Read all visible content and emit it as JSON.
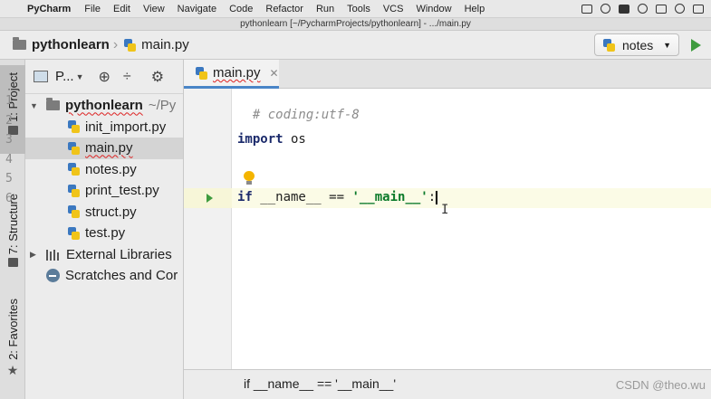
{
  "menubar": {
    "app_name": "PyCharm",
    "items": [
      "File",
      "Edit",
      "View",
      "Navigate",
      "Code",
      "Refactor",
      "Run",
      "Tools",
      "VCS",
      "Window",
      "Help"
    ]
  },
  "window": {
    "title": "pythonlearn [~/PycharmProjects/pythonlearn] - .../main.py"
  },
  "navbar": {
    "project": "pythonlearn",
    "file": "main.py",
    "run_config": "notes"
  },
  "side_tabs": {
    "project": "1: Project",
    "structure": "7: Structure",
    "favorites": "2: Favorites"
  },
  "project_panel": {
    "view_selector": "P...",
    "root": {
      "name": "pythonlearn",
      "hint": "~/Py"
    },
    "files": [
      "init_import.py",
      "main.py",
      "notes.py",
      "print_test.py",
      "struct.py",
      "test.py"
    ],
    "external_libraries": "External Libraries",
    "scratches": "Scratches and Cor"
  },
  "editor": {
    "tab_label": "main.py",
    "line_numbers": [
      "1",
      "2",
      "3",
      "4",
      "5",
      "6"
    ],
    "line1_comment": "# coding:utf-8",
    "line3_kw": "import",
    "line3_rest": " os",
    "line6_kw": "if",
    "line6_mid": " __name__ == ",
    "line6_str": "'__main__'",
    "line6_end": ":",
    "breadcrumb": "if __name__ == '__main__'"
  },
  "watermark": "CSDN @theo.wu",
  "colors": {
    "accent_blue": "#4a85c7",
    "run_green": "#3e9b3e",
    "keyword": "#1b2a6b",
    "string": "#0b7a2a",
    "comment": "#8c8c8c"
  }
}
